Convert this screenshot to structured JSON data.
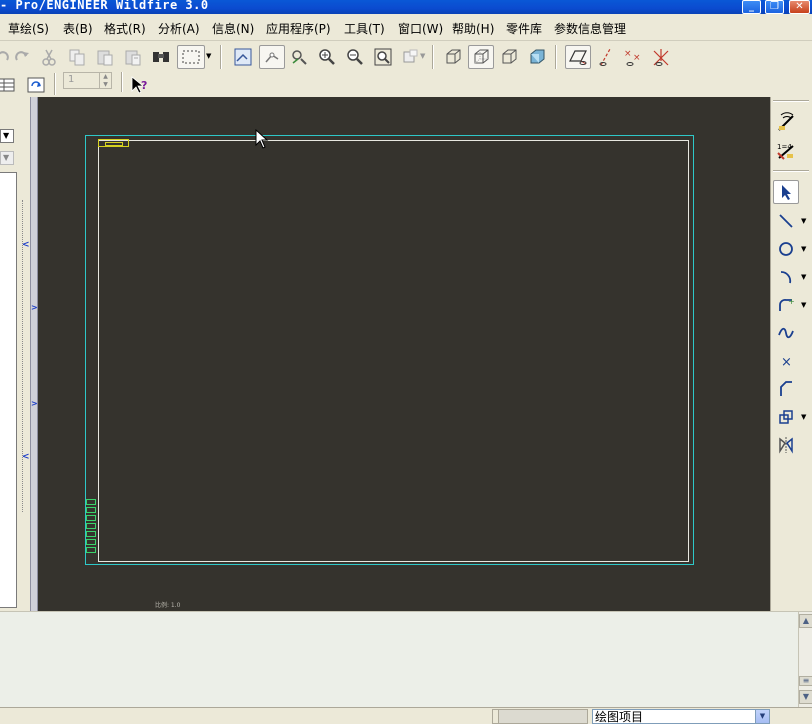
{
  "titlebar": {
    "title": "- Pro/ENGINEER Wildfire 3.0",
    "minimize": "_",
    "restore": "❐",
    "close": "✕"
  },
  "menu": {
    "items": [
      {
        "label": "草绘(S)"
      },
      {
        "label": "表(B)"
      },
      {
        "label": "格式(R)"
      },
      {
        "label": "分析(A)"
      },
      {
        "label": "信息(N)"
      },
      {
        "label": "应用程序(P)"
      },
      {
        "label": "工具(T)"
      },
      {
        "label": "窗口(W)"
      },
      {
        "label": "帮助(H)"
      },
      {
        "label": "零件库"
      },
      {
        "label": "参数信息管理"
      }
    ]
  },
  "toolbar": {
    "sheet_number": "1"
  },
  "canvas": {
    "scale_text": "比例: 1.0",
    "background": "#35332d",
    "border_color": "#2ec8c8"
  },
  "status": {
    "filter_value": "绘图项目"
  }
}
